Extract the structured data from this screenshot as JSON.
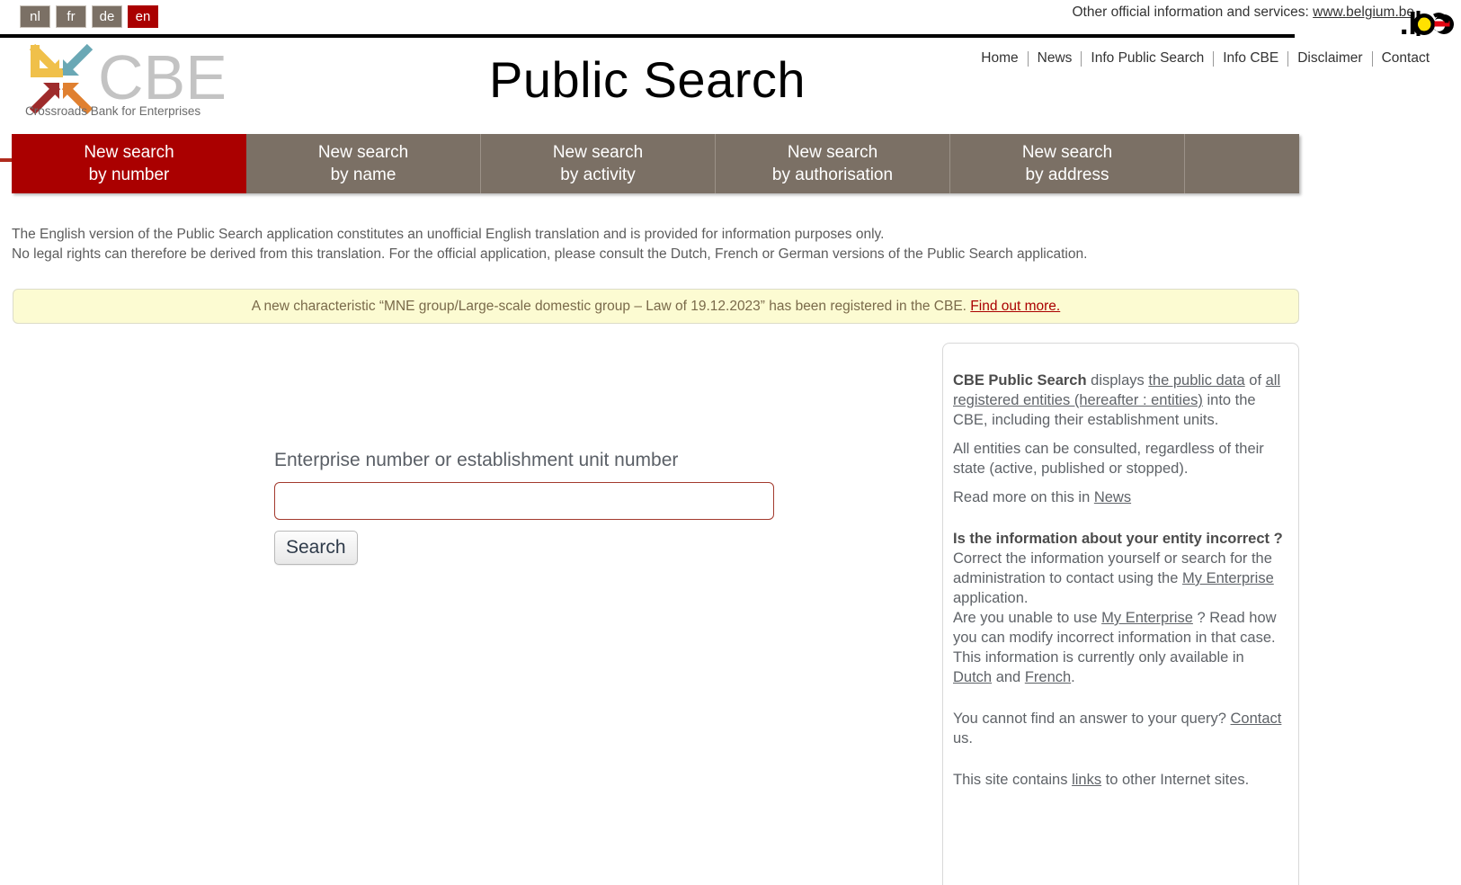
{
  "topbar": {
    "languages": [
      {
        "code": "nl",
        "active": false
      },
      {
        "code": "fr",
        "active": false
      },
      {
        "code": "de",
        "active": false
      },
      {
        "code": "en",
        "active": true
      }
    ],
    "other_info_prefix": "Other official information and services: ",
    "other_info_link": "www.belgium.be",
    "be_logo_text": ".be"
  },
  "header": {
    "logo_text": "CBE",
    "logo_tagline": "Crossroads Bank for Enterprises",
    "title": "Public Search",
    "nav": [
      {
        "label": "Home"
      },
      {
        "label": "News"
      },
      {
        "label": "Info Public Search"
      },
      {
        "label": "Info CBE"
      },
      {
        "label": "Disclaimer"
      },
      {
        "label": "Contact"
      }
    ]
  },
  "tabs": [
    {
      "line1": "New search",
      "line2": "by number",
      "active": true
    },
    {
      "line1": "New search",
      "line2": "by name",
      "active": false
    },
    {
      "line1": "New search",
      "line2": "by activity",
      "active": false
    },
    {
      "line1": "New search",
      "line2": "by authorisation",
      "active": false
    },
    {
      "line1": "New search",
      "line2": "by address",
      "active": false
    }
  ],
  "notice": {
    "line1": "The English version of the Public Search application constitutes an unofficial English translation and is provided for information purposes only.",
    "line2": "No legal rights can therefore be derived from this translation. For the official application, please consult the Dutch, French or German versions of the Public Search application."
  },
  "alert": {
    "text": "A new characteristic “MNE group/Large-scale domestic group – Law of 19.12.2023” has been registered in the CBE. ",
    "link": "Find out more."
  },
  "search": {
    "label": "Enterprise number or establishment unit number",
    "value": "",
    "placeholder": "",
    "button_label": "Search"
  },
  "sidebar": {
    "p1_bold": "CBE Public Search",
    "p1_a": " displays ",
    "p1_link1": "the public data",
    "p1_b": " of ",
    "p1_link2": "all registered entities (hereafter : entities)",
    "p1_c": " into the CBE, including their establishment units.",
    "p2": "All entities can be consulted, regardless of their state (active, published or stopped).",
    "p3_a": "Read more on this in ",
    "p3_link": "News",
    "h1": "Is the information about your entity incorrect ?",
    "p4_a": "Correct the information yourself or search for the administration to contact using the ",
    "p4_link": "My Enterprise",
    "p4_b": " application.",
    "p5_a": "Are you unable to use ",
    "p5_link": "My Enterprise",
    "p5_b": " ? Read how you can modify incorrect information in that case.",
    "p6_a": "This information is currently only available in ",
    "p6_link1": "Dutch",
    "p6_b": " and ",
    "p6_link2": "French",
    "p6_c": ".",
    "p7_a": "You cannot find an answer to your query? ",
    "p7_link": "Contact",
    "p7_b": " us.",
    "p8_a": "This site contains ",
    "p8_link": "links",
    "p8_b": " to other Internet sites."
  }
}
